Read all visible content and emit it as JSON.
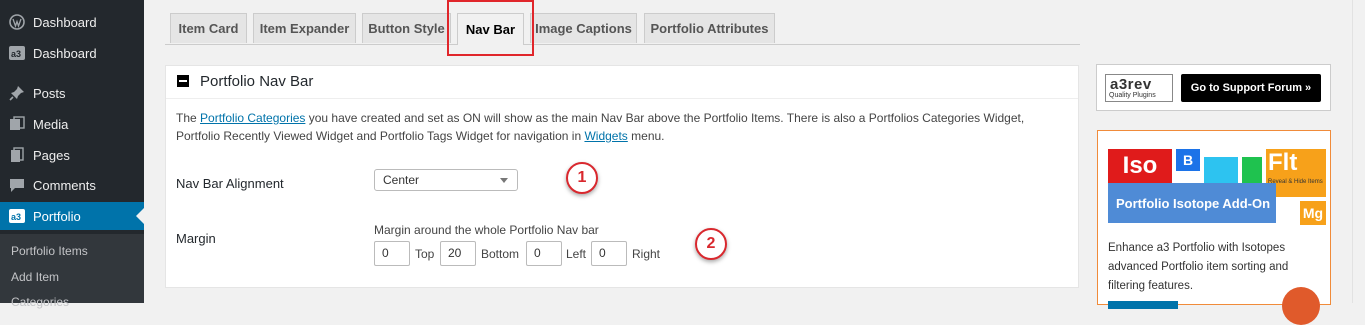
{
  "sidebar": {
    "items": [
      {
        "label": "Dashboard",
        "icon": "wordpress-icon"
      },
      {
        "label": "Dashboard",
        "icon": "a3-icon"
      },
      {
        "label": "Posts",
        "icon": "pin-icon"
      },
      {
        "label": "Media",
        "icon": "media-icon"
      },
      {
        "label": "Pages",
        "icon": "pages-icon"
      },
      {
        "label": "Comments",
        "icon": "comments-icon"
      },
      {
        "label": "Portfolio",
        "icon": "a3-icon"
      }
    ],
    "submenu": [
      "Portfolio Items",
      "Add Item",
      "Categories"
    ]
  },
  "tabs": [
    "Item Card",
    "Item Expander",
    "Button Style",
    "Nav Bar",
    "Image Captions",
    "Portfolio Attributes"
  ],
  "active_tab": "Nav Bar",
  "panel": {
    "title": "Portfolio Nav Bar",
    "desc_prefix": "The ",
    "desc_link1": "Portfolio Categories",
    "desc_middle": " you have created and set as ON will show as the main Nav Bar above the Portfolio Items. There is also a Portfolios Categories Widget, Portfolio Recently Viewed Widget and Portfolio Tags Widget for navigation in ",
    "desc_link2": "Widgets",
    "desc_suffix": " menu.",
    "alignment_label": "Nav Bar Alignment",
    "alignment_value": "Center",
    "margin_label": "Margin",
    "margin_help": "Margin around the whole Portfolio Nav bar",
    "margins": [
      {
        "value": "0",
        "label": "Top"
      },
      {
        "value": "20",
        "label": "Bottom"
      },
      {
        "value": "0",
        "label": "Left"
      },
      {
        "value": "0",
        "label": "Right"
      }
    ]
  },
  "badges": [
    "1",
    "2"
  ],
  "support": {
    "logo_brand": "a3rev",
    "logo_sub": "Quality Plugins",
    "button": "Go to Support Forum »"
  },
  "promo": {
    "art_iso": "Iso",
    "art_b": "B",
    "art_flt": "Flt",
    "art_reveal": "Reveal & Hide Items",
    "art_title": "Portfolio Isotope Add-On",
    "art_mg": "Mg",
    "text": "Enhance a3 Portfolio with Isotopes advanced Portfolio item sorting and filtering features."
  },
  "colors": {
    "sidebar_bg": "#23282d",
    "accent": "#0073aa",
    "highlight_red": "#e0262b",
    "promo_orange": "#f08b3a"
  }
}
